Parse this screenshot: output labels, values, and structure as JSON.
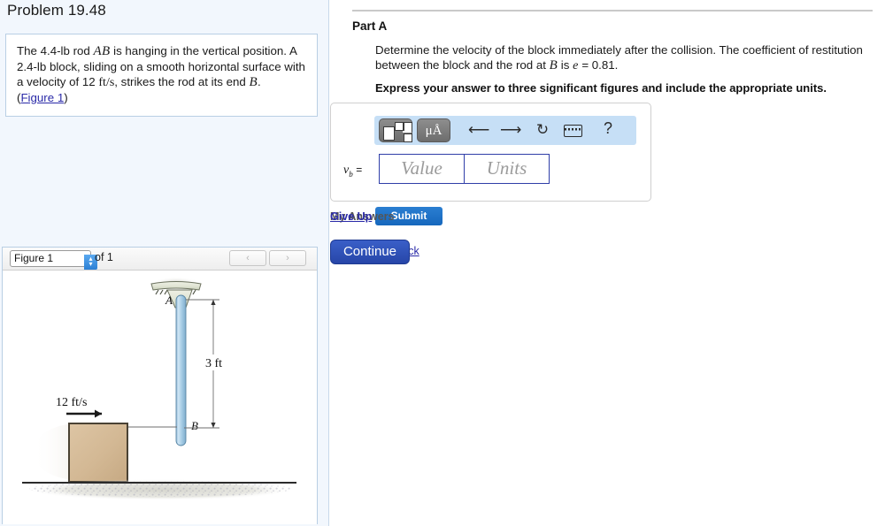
{
  "problem": {
    "title": "Problem 19.48",
    "statement_parts": {
      "s1": "The 4.4-lb rod ",
      "rod_label": "AB",
      "s2": " is hanging in the vertical position. A 2.4-lb block, sliding on a smooth horizontal surface with a velocity of 12 ",
      "units_ftps": "ft/s",
      "s3": ", strikes the rod at its end ",
      "end_label": "B",
      "s4": ".",
      "figure_link": "Figure 1",
      "paren_open": "(",
      "paren_close": ")"
    }
  },
  "figure_panel": {
    "selected_figure": "Figure 1",
    "of_count": "of 1",
    "prev_label": "‹",
    "next_label": "›",
    "spinner_up": "▴",
    "spinner_down": "▾",
    "diagram": {
      "label_a": "A",
      "label_b": "B",
      "dimension": "3 ft",
      "velocity": "12 ft/s"
    }
  },
  "part_a": {
    "heading": "Part A",
    "question_1": "Determine the velocity of the block immediately after the collision. The coefficient of restitution between the block and the rod at ",
    "question_b": "B",
    "question_2": " is ",
    "question_e": "e",
    "question_3": " = 0.81.",
    "instruction": "Express your answer to three significant figures and include the appropriate units."
  },
  "answer_widget": {
    "toolbar": {
      "template_icon": "math-template-icon",
      "units_icon": "μÅ",
      "undo_icon": "⬅",
      "redo_icon": "➡",
      "reset_icon": "↺",
      "keyboard_icon": "keyboard-icon",
      "help_icon": "?"
    },
    "variable_label": "v",
    "variable_sub": "b",
    "equals": "=",
    "value_placeholder": "Value",
    "units_placeholder": "Units",
    "value_current": "",
    "units_current": ""
  },
  "actions": {
    "submit": "Submit",
    "my_answers": "My Answers",
    "give_up": "Give Up",
    "provide_feedback": "Provide Feedback",
    "continue": "Continue"
  },
  "colors": {
    "panel_bg": "#f2f7fd",
    "toolbar_bg": "#c6dff6",
    "submit_blue": "#1667bd",
    "continue_blue": "#2746a8",
    "link_blue": "#2a2aa8",
    "rod_blue": "#a8cde6",
    "block_tan": "#d3b894"
  }
}
